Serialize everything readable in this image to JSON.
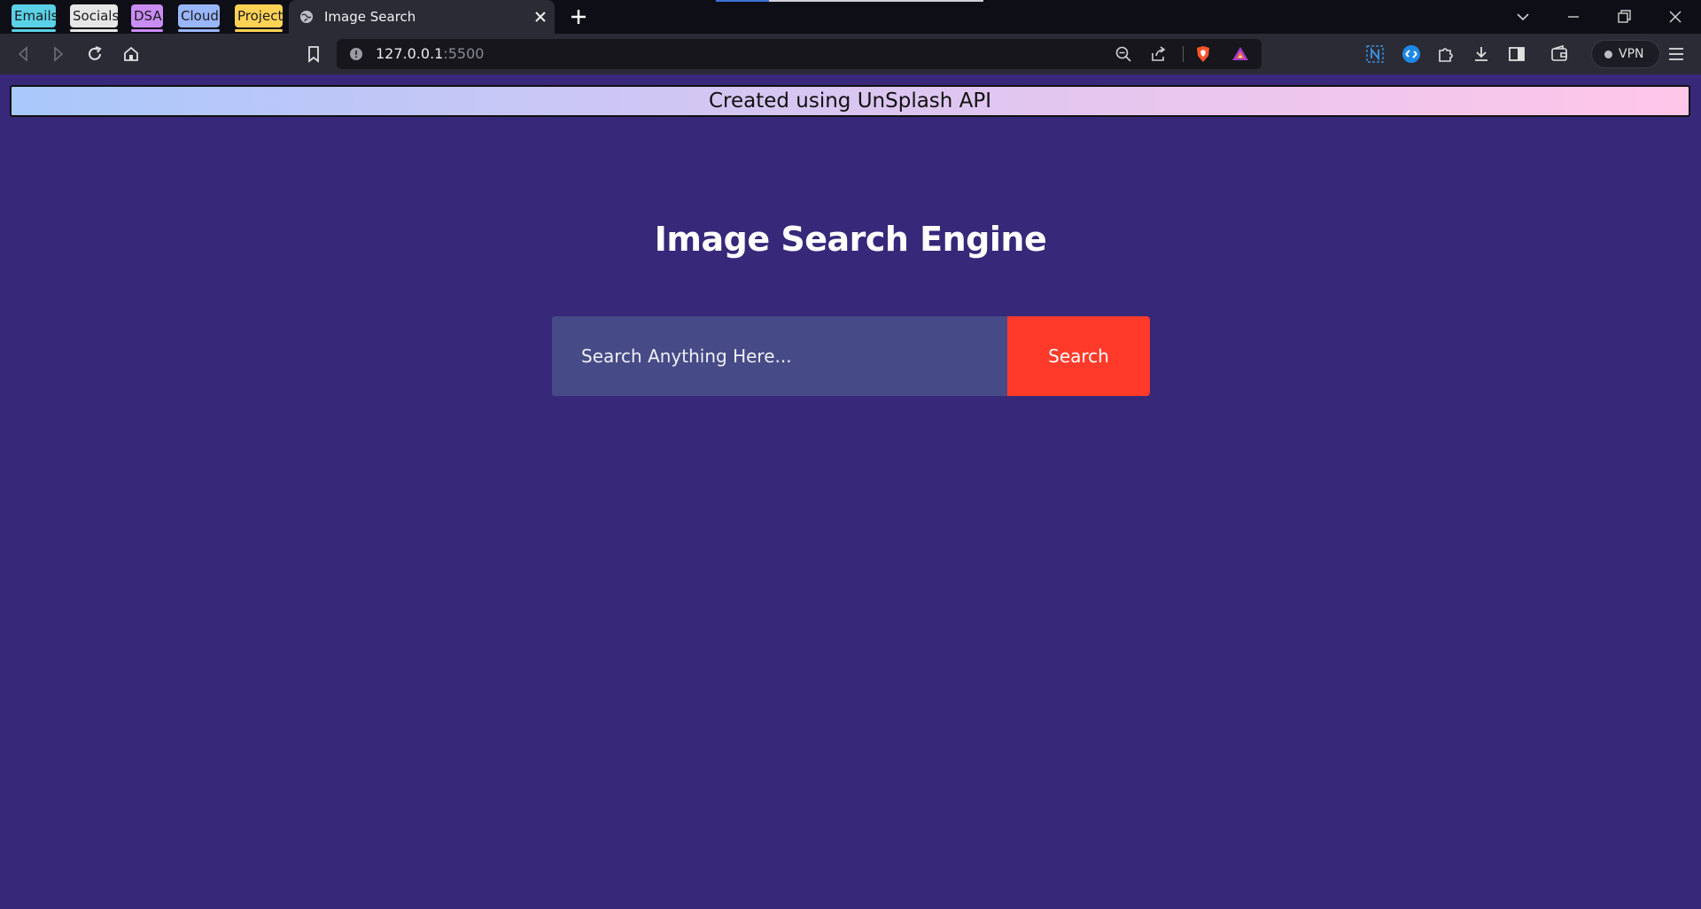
{
  "browser": {
    "tab_groups": [
      {
        "label": "Emails",
        "color": "#5ad1e6"
      },
      {
        "label": "Socials",
        "color": "#e6e6e6"
      },
      {
        "label": "DSA",
        "color": "#c98cf5"
      },
      {
        "label": "Cloud",
        "color": "#9ab6fb"
      },
      {
        "label": "Project",
        "color": "#ffd255"
      }
    ],
    "active_tab_title": "Image Search",
    "url_host": "127.0.0.1",
    "url_port": ":5500",
    "vpn_label": "VPN"
  },
  "page": {
    "banner": "Created using UnSplash API",
    "heading": "Image Search Engine",
    "search": {
      "placeholder": "Search Anything Here...",
      "button_label": "Search"
    },
    "colors": {
      "background": "#37287a",
      "input_bg": "#464a86",
      "button_bg": "#ff3a2a"
    }
  }
}
